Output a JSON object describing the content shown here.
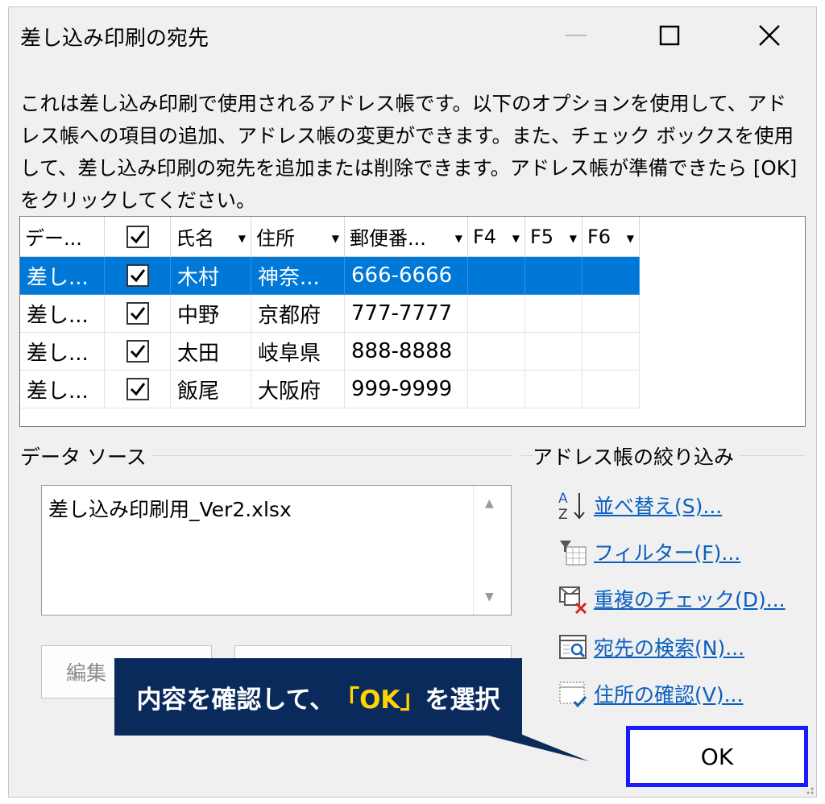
{
  "window": {
    "title": "差し込み印刷の宛先",
    "minimize_icon": "minimize-icon",
    "maximize_icon": "maximize-icon",
    "close_icon": "close-icon"
  },
  "description": "これは差し込み印刷で使用されるアドレス帳です。以下のオプションを使用して、アドレス帳への項目の追加、アドレス帳の変更ができます。また、チェック ボックスを使用して、差し込み印刷の宛先を追加または削除できます。アドレス帳が準備できたら [OK] をクリックしてください。",
  "grid": {
    "headers": [
      "デー...",
      "",
      "氏名",
      "住所",
      "郵便番...",
      "F4",
      "F5",
      "F6"
    ],
    "rows": [
      {
        "source": "差し...",
        "checked": true,
        "name": "木村",
        "address": "神奈...",
        "zip": "666-6666",
        "selected": true
      },
      {
        "source": "差し...",
        "checked": true,
        "name": "中野",
        "address": "京都府",
        "zip": "777-7777",
        "selected": false
      },
      {
        "source": "差し...",
        "checked": true,
        "name": "太田",
        "address": "岐阜県",
        "zip": "888-8888",
        "selected": false
      },
      {
        "source": "差し...",
        "checked": true,
        "name": "飯尾",
        "address": "大阪府",
        "zip": "999-9999",
        "selected": false
      }
    ]
  },
  "data_source": {
    "label": "データ ソース",
    "items": [
      "差し込み印刷用_Ver2.xlsx"
    ],
    "edit_button": "編集"
  },
  "refine": {
    "label": "アドレス帳の絞り込み",
    "links": [
      {
        "label": "並べ替え(S)...",
        "icon": "sort-az-icon"
      },
      {
        "label": "フィルター(F)...",
        "icon": "filter-icon"
      },
      {
        "label": "重複のチェック(D)...",
        "icon": "duplicate-check-icon"
      },
      {
        "label": "宛先の検索(N)...",
        "icon": "search-recipient-icon"
      },
      {
        "label": "住所の確認(V)...",
        "icon": "verify-address-icon"
      }
    ]
  },
  "ok_button": "OK",
  "callout": {
    "before": "内容を確認して、",
    "highlight": "「OK」",
    "after": "を選択"
  },
  "colors": {
    "selection": "#0078d7",
    "link": "#0a5fbf",
    "callout_bg": "#0a2a5c",
    "callout_highlight": "#ffd400",
    "ok_border": "#1a1aff"
  }
}
